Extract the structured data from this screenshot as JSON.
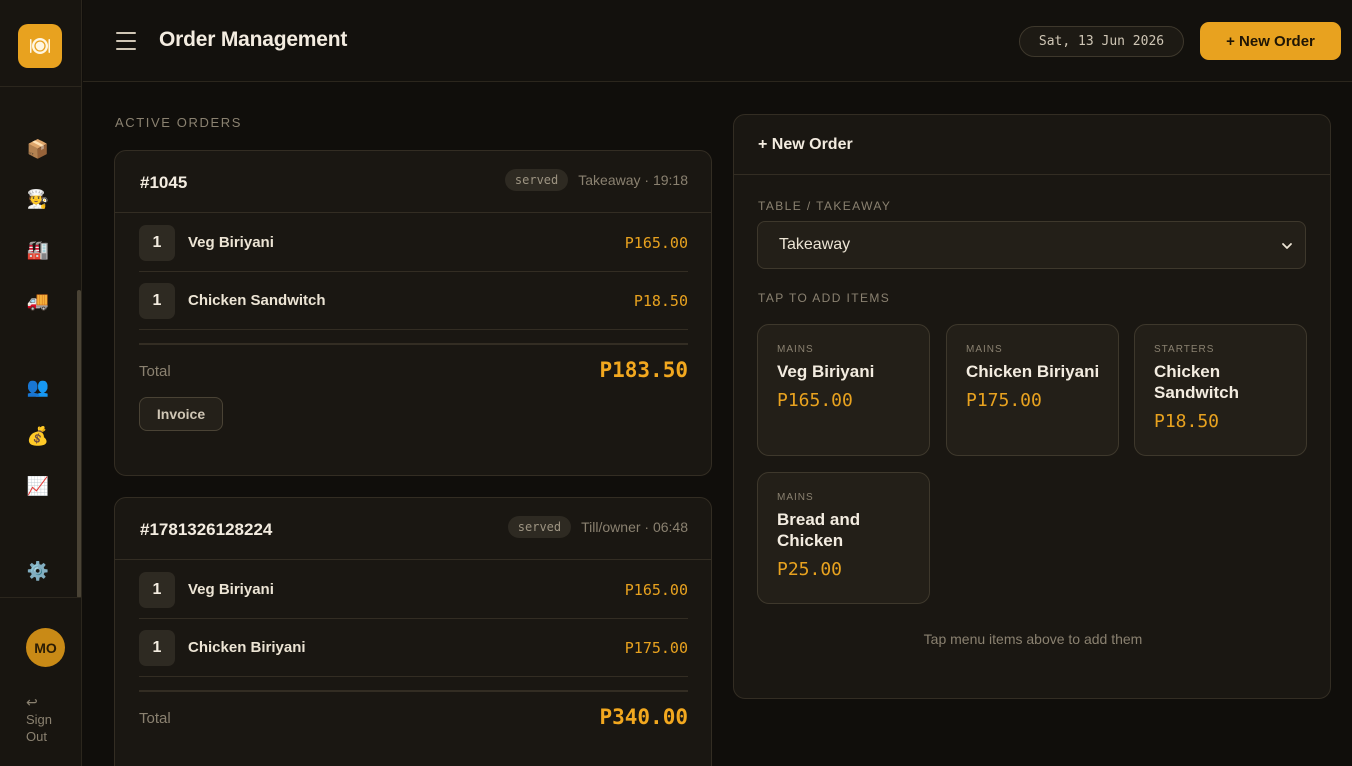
{
  "app": {
    "logo_icon": "plate-icon",
    "accent": "#e8a21f"
  },
  "sidebar": {
    "items": [
      {
        "name": "inventory-icon",
        "glyph": "📦"
      },
      {
        "name": "chef-icon",
        "glyph": "🧑‍🍳"
      },
      {
        "name": "factory-icon",
        "glyph": "🏭"
      },
      {
        "name": "delivery-truck-icon",
        "glyph": "🚚"
      },
      {
        "name": "users-icon",
        "glyph": "👥"
      },
      {
        "name": "money-bag-icon",
        "glyph": "💰"
      },
      {
        "name": "chart-icon",
        "glyph": "📈"
      },
      {
        "name": "settings-icon",
        "glyph": "⚙️"
      }
    ],
    "avatar_initials": "MO",
    "signout_icon": "↩",
    "signout_label": "Sign Out"
  },
  "header": {
    "title": "Order Management",
    "date": "Sat, 13 Jun 2026",
    "new_order_button": "+ New Order"
  },
  "orders": {
    "section_label": "ACTIVE ORDERS",
    "list": [
      {
        "number": "#1045",
        "status": "served",
        "meta": "Takeaway · 19:18",
        "items": [
          {
            "qty": "1",
            "name": "Veg Biriyani",
            "price": "P165.00"
          },
          {
            "qty": "1",
            "name": "Chicken Sandwitch",
            "price": "P18.50"
          }
        ],
        "total_label": "Total",
        "total": "P183.50",
        "invoice_button": "Invoice"
      },
      {
        "number": "#1781326128224",
        "status": "served",
        "meta": "Till/owner · 06:48",
        "items": [
          {
            "qty": "1",
            "name": "Veg Biriyani",
            "price": "P165.00"
          },
          {
            "qty": "1",
            "name": "Chicken Biriyani",
            "price": "P175.00"
          }
        ],
        "total_label": "Total",
        "total": "P340.00"
      }
    ]
  },
  "new_order": {
    "title": "+ New Order",
    "table_label": "TABLE / TAKEAWAY",
    "table_value": "Takeaway",
    "items_label": "TAP TO ADD ITEMS",
    "menu": [
      {
        "category": "MAINS",
        "name": "Veg Biriyani",
        "price": "P165.00"
      },
      {
        "category": "MAINS",
        "name": "Chicken Biriyani",
        "price": "P175.00"
      },
      {
        "category": "STARTERS",
        "name": "Chicken Sandwitch",
        "price": "P18.50"
      },
      {
        "category": "MAINS",
        "name": "Bread and Chicken",
        "price": "P25.00"
      }
    ],
    "hint": "Tap menu items above to add them"
  }
}
